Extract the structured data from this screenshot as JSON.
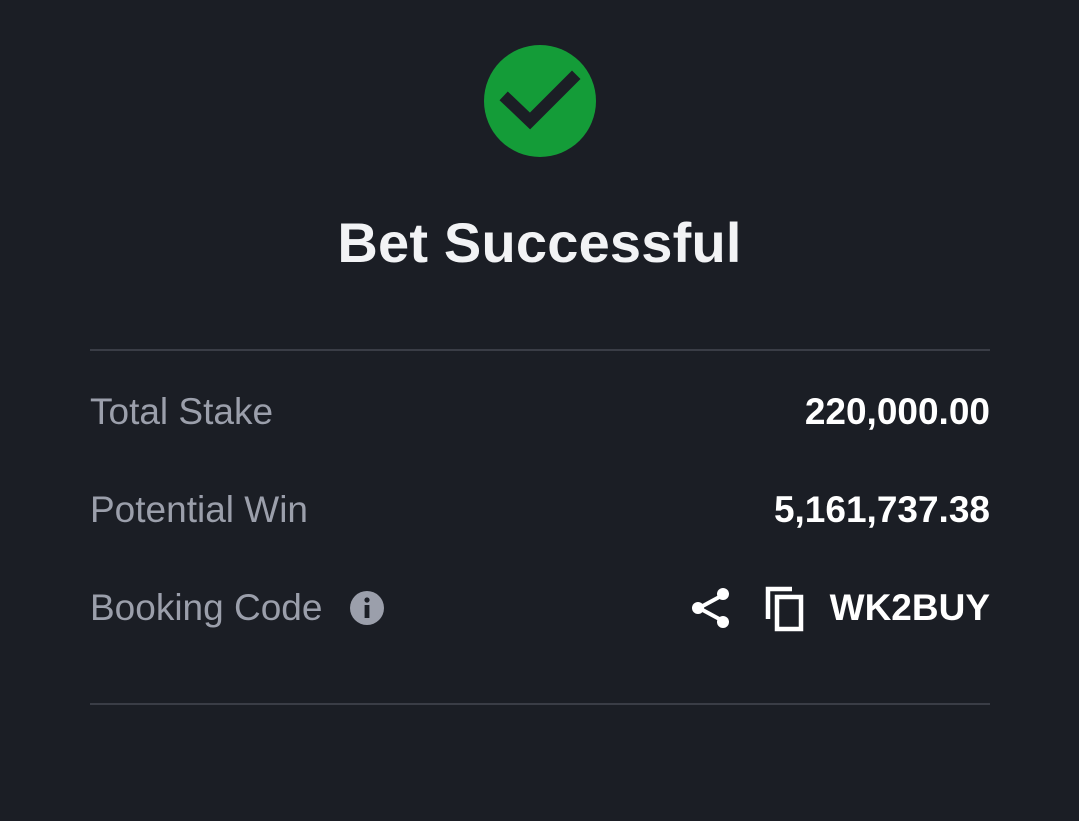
{
  "status": {
    "icon": "check-circle-icon",
    "title": "Bet Successful",
    "accent_color": "#149c38"
  },
  "details": {
    "total_stake_label": "Total Stake",
    "total_stake_value": "220,000.00",
    "potential_win_label": "Potential Win",
    "potential_win_value": "5,161,737.38",
    "booking_code_label": "Booking Code",
    "booking_code_value": "WK2BUY"
  },
  "icons": {
    "info": "info-icon",
    "share": "share-icon",
    "copy": "copy-icon"
  },
  "colors": {
    "background": "#1b1e25",
    "label": "#9b9fab",
    "value": "#ffffff",
    "divider": "#3a3d46"
  }
}
